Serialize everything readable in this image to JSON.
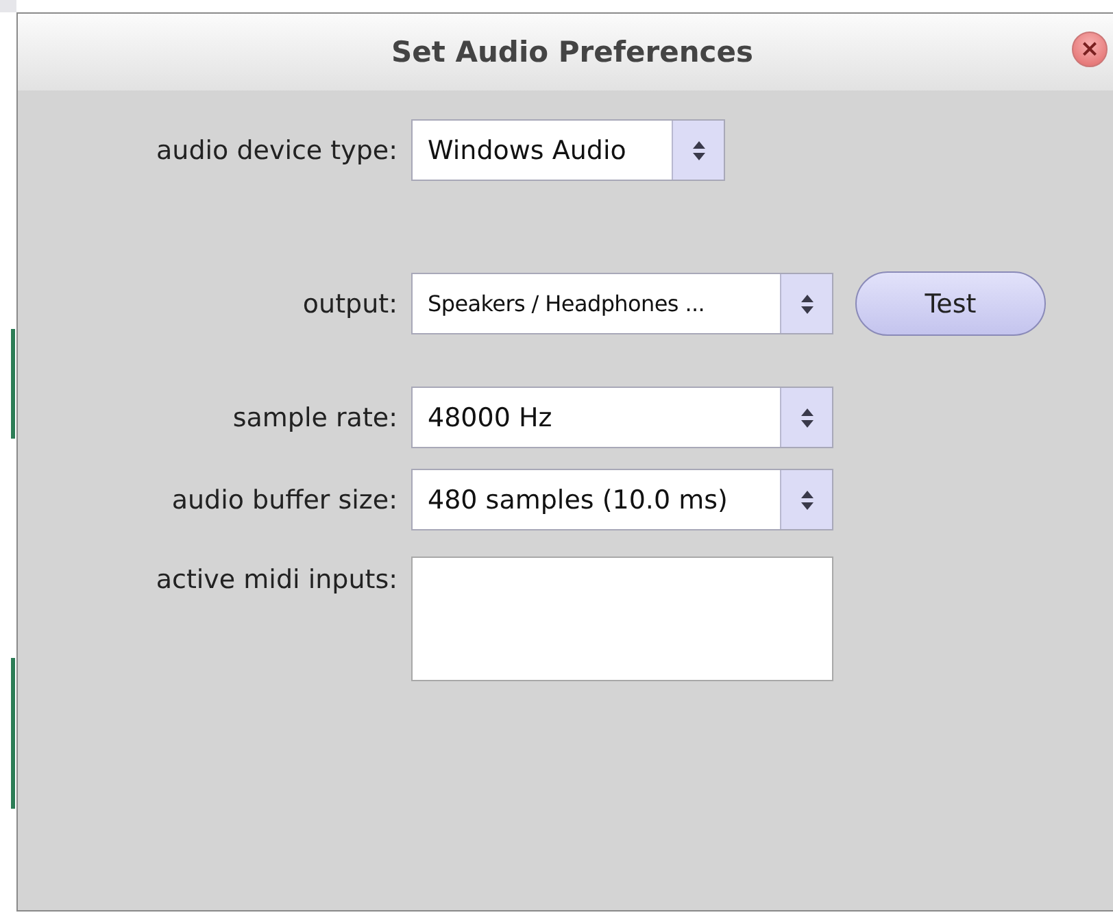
{
  "window": {
    "title": "Set Audio Preferences",
    "close_button": "×"
  },
  "settings": [
    {
      "label": "audio device type:",
      "kind": "combo",
      "value": "Windows Audio"
    },
    {
      "label": "output:",
      "kind": "combo",
      "value": "Speakers / Headphones ...",
      "button": "Test"
    },
    {
      "label": "sample rate:",
      "kind": "combo",
      "value": "48000 Hz"
    },
    {
      "label": "audio buffer size:",
      "kind": "combo",
      "value": "480 samples (10.0 ms)"
    },
    {
      "label": "active midi inputs:",
      "kind": "list"
    }
  ]
}
